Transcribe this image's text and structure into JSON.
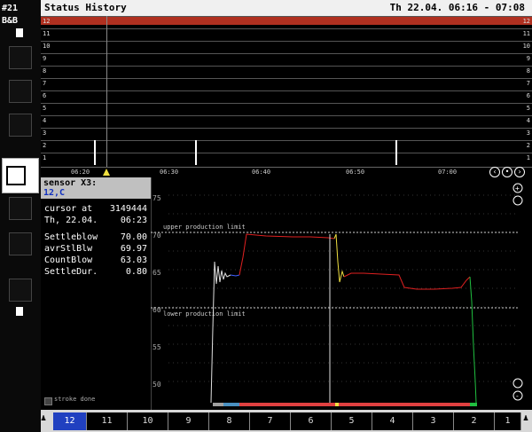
{
  "app": {
    "id": "#21",
    "subtitle": "B&B"
  },
  "header": {
    "title": "Status History",
    "time_range": "Th 22.04. 06:16 - 07:08"
  },
  "history": {
    "lanes": [
      "12",
      "11",
      "10",
      "9",
      "8",
      "7",
      "6",
      "5",
      "4",
      "3",
      "2",
      "1"
    ],
    "time_ticks": [
      "06:20",
      "06:30",
      "06:40",
      "06:50",
      "07:00"
    ]
  },
  "sensor": {
    "title": "sensor X3:",
    "id": "12,C",
    "cursor_label": "cursor at",
    "cursor_value": "3149444",
    "date": "Th, 22.04.",
    "time": "06:23",
    "rows": [
      {
        "label": "Settleblow",
        "value": "70.00"
      },
      {
        "label": "avrStlBlw",
        "value": "69.97"
      },
      {
        "label": "CountBlow",
        "value": "63.03"
      },
      {
        "label": "SettleDur.",
        "value": "0.80"
      }
    ],
    "stroke_label": "stroke done"
  },
  "chart": {
    "upper_limit_label": "upper production limit",
    "lower_limit_label": "lower production limit",
    "y_labels": [
      "75",
      "70",
      "65",
      "60",
      "55",
      "50"
    ]
  },
  "bottombar": {
    "cells": [
      "12",
      "11",
      "10",
      "9",
      "8",
      "7",
      "6",
      "5",
      "4",
      "3",
      "2",
      "1"
    ]
  },
  "colors": {
    "trace_red": "#e02020",
    "trace_yellow": "#f0e040",
    "trace_green": "#20c040",
    "trace_white": "#e0e0e0",
    "trace_blue": "#4060ff"
  }
}
